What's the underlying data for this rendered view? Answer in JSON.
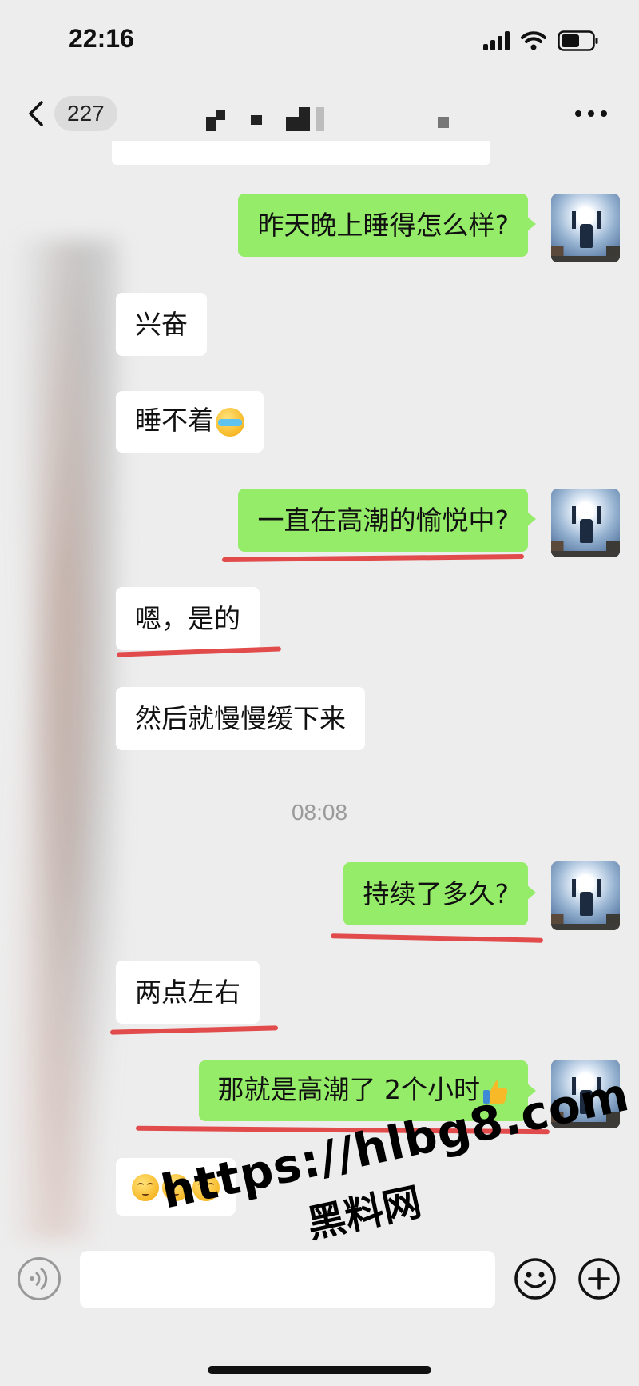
{
  "status_bar": {
    "time": "22:16"
  },
  "nav": {
    "back_label": "<",
    "unread_count": "227"
  },
  "messages": [
    {
      "id": "m1",
      "side": "out",
      "text": "昨天晚上睡得怎么样?"
    },
    {
      "id": "m2",
      "side": "in",
      "text": "兴奋"
    },
    {
      "id": "m3",
      "side": "in",
      "text": "睡不着",
      "emoji": "crying-laughing-face"
    },
    {
      "id": "m4",
      "side": "out",
      "text": "一直在高潮的愉悦中?"
    },
    {
      "id": "m5",
      "side": "in",
      "text": "嗯，是的"
    },
    {
      "id": "m6",
      "side": "in",
      "text": "然后就慢慢缓下来"
    },
    {
      "id": "m7",
      "side": "out",
      "text": "持续了多久?"
    },
    {
      "id": "m8",
      "side": "in",
      "text": "两点左右"
    },
    {
      "id": "m9",
      "side": "out",
      "text": "那就是高潮了 2个小时",
      "emoji": "thumbs-up"
    },
    {
      "id": "m10",
      "side": "in",
      "text": "",
      "emoji": "smiling-face-x3"
    }
  ],
  "timestamp": "08:08",
  "watermark": {
    "url": "https://hlbg8.com",
    "site": "黑料网"
  },
  "colors": {
    "outgoing_bubble": "#95ec69",
    "incoming_bubble": "#ffffff",
    "background": "#ededed",
    "annotation": "#e14b4b"
  }
}
